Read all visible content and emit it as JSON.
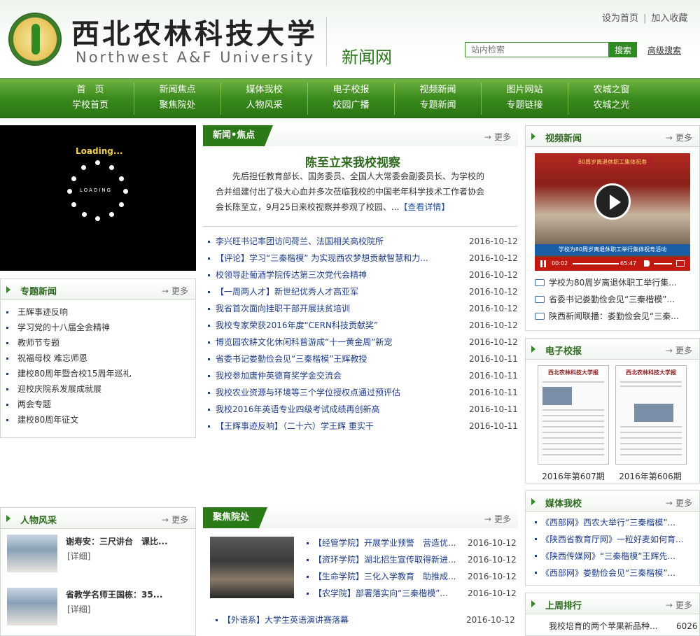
{
  "header": {
    "logo_cn": "西北农林科技大学",
    "logo_en": "Northwest A&F University",
    "site_name": "新闻网",
    "top_link_home": "设为首页",
    "top_link_fav": "加入收藏",
    "search_placeholder": "站内检索",
    "search_button": "搜索",
    "advanced_search": "高级搜索"
  },
  "nav": [
    {
      "top": "首　页",
      "bottom": "学校首页"
    },
    {
      "top": "新闻焦点",
      "bottom": "聚焦院处"
    },
    {
      "top": "媒体我校",
      "bottom": "人物风采"
    },
    {
      "top": "电子校报",
      "bottom": "校园广播"
    },
    {
      "top": "视频新闻",
      "bottom": "专题新闻"
    },
    {
      "top": "图片网站",
      "bottom": "专题链接"
    },
    {
      "top": "农城之窗",
      "bottom": "农城之光"
    }
  ],
  "loading": {
    "title": "Loading...",
    "sub": "LOADING"
  },
  "special": {
    "title": "专题新闻",
    "more": "更多",
    "items": [
      "王辉事迹反响",
      "学习党的十八届全会精神",
      "教师节专题",
      "祝福母校 难忘师恩",
      "建校80周年暨合校15周年巡礼",
      "迎校庆院系发展成就展",
      "两会专题",
      "建校80周年征文"
    ]
  },
  "focus_news": {
    "title": "新闻•焦点",
    "more": "更多",
    "headline": "陈至立来我校视察",
    "body": "先后担任教育部长、国务委员、全国人大常委会副委员长、为学校的合并组建付出了极大心血并多次莅临我校的中国老年科学技术工作者协会会长陈至立，9月25日来校视察并参观了校园、...",
    "detail": "【查看详情】",
    "items": [
      {
        "title": "李兴旺书记率团访问荷兰、法国相关高校院所",
        "date": "2016-10-12"
      },
      {
        "title": "【评论】学习“三秦楷模” 为实现西农梦想贡献智慧和力...",
        "date": "2016-10-12"
      },
      {
        "title": "校领导赴葡酒学院传达第三次党代会精神",
        "date": "2016-10-12"
      },
      {
        "title": "【一周两人才】新世纪优秀人才高亚军",
        "date": "2016-10-12"
      },
      {
        "title": "我省首次面向挂职干部开展扶贫培训",
        "date": "2016-10-12"
      },
      {
        "title": "我校专家荣获2016年度“CERN科技贡献奖”",
        "date": "2016-10-12"
      },
      {
        "title": "博览园农耕文化休闲科普游成“十一黄金周”新宠",
        "date": "2016-10-12"
      },
      {
        "title": "省委书记娄勤俭会见“三秦楷模”王辉教授",
        "date": "2016-10-11"
      },
      {
        "title": "我校参加唐仲英德育奖学金交流会",
        "date": "2016-10-11"
      },
      {
        "title": "我校农业资源与环境等三个学位授权点通过预评估",
        "date": "2016-10-11"
      },
      {
        "title": "我校2016年英语专业四级考试成绩再创新高",
        "date": "2016-10-11"
      },
      {
        "title": "【王辉事迹反响】（二十六）学王辉 重实干",
        "date": "2016-10-11"
      }
    ]
  },
  "video": {
    "title": "视频新闻",
    "more": "更多",
    "banner": "80周岁离退休职工集体祝寿",
    "caption": "学校为80周岁离退休职工举行集体祝寿活动",
    "time_current": "00:02",
    "time_total": "65:47",
    "items": [
      "学校为80周岁离退休职工举行集...",
      "省委书记娄勤俭会见“三秦楷模”...",
      "陕西新闻联播：娄勤俭会见“三秦..."
    ]
  },
  "epaper": {
    "title": "电子校报",
    "more": "更多",
    "masthead": "西北农林科技大学报",
    "issues": [
      "2016年第607期",
      "2016年第606期"
    ]
  },
  "media": {
    "title": "媒体我校",
    "more": "更多",
    "items": [
      "《西部网》西农大举行“三秦楷模”...",
      "《陕西省教育厅网》一粒好麦如何育...",
      "《陕西传媒网》“三秦楷模”王辉先...",
      "《西部网》娄勤俭会见“三秦楷模”..."
    ]
  },
  "people": {
    "title": "人物风采",
    "more": "更多",
    "items": [
      {
        "name": "谢寿安：三尺讲台　课比...",
        "detail": "[详细]"
      },
      {
        "name": "省教学名师王国栋：35...",
        "detail": "[详细]"
      }
    ]
  },
  "colleges": {
    "title": "聚焦院处",
    "more": "更多",
    "items": [
      {
        "title": "【经管学院】开展学业预警　营造优...",
        "date": "2016-10-12"
      },
      {
        "title": "【资环学院】湖北招生宣传取得新进...",
        "date": "2016-10-12"
      },
      {
        "title": "【生命学院】三化入学教育　助推成...",
        "date": "2016-10-12"
      },
      {
        "title": "【农学院】部署落实向“三秦楷模”...",
        "date": "2016-10-12"
      },
      {
        "title": "【外语系】大学生英语演讲赛落幕",
        "date": "2016-10-12"
      }
    ]
  },
  "ranking": {
    "title": "上周排行",
    "more": "更多",
    "items": [
      {
        "title": "我校培育的两个苹果新品种...",
        "count": "6026"
      }
    ]
  }
}
